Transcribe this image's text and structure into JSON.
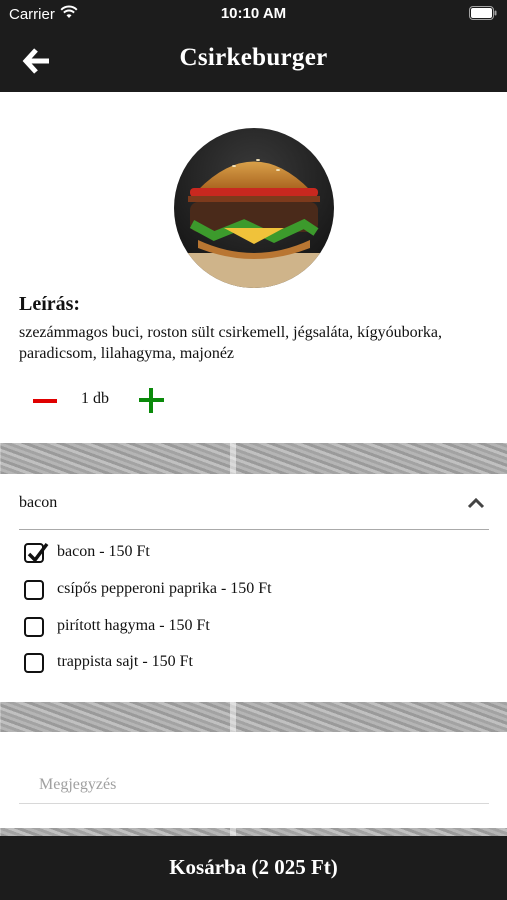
{
  "status_bar": {
    "carrier": "Carrier",
    "time": "10:10 AM"
  },
  "nav": {
    "title": "Csirkeburger"
  },
  "product": {
    "description_title": "Leírás:",
    "description": "szezámmagos buci, roston sült csirkemell, jégsaláta, kígyóuborka, paradicsom, lilahagyma, majonéz",
    "quantity": "1 db"
  },
  "options": {
    "group_label": "bacon",
    "items": [
      {
        "label": "bacon - 150 Ft",
        "checked": true
      },
      {
        "label": "csípős pepperoni paprika - 150 Ft",
        "checked": false
      },
      {
        "label": "pirított hagyma - 150 Ft",
        "checked": false
      },
      {
        "label": "trappista sajt - 150 Ft",
        "checked": false
      }
    ]
  },
  "note": {
    "placeholder": "Megjegyzés",
    "value": ""
  },
  "cart": {
    "button_label": "Kosárba (2 025 Ft)"
  },
  "colors": {
    "bar_background": "#1c1c1c",
    "minus": "#e00000",
    "plus": "#0a8a0a"
  }
}
